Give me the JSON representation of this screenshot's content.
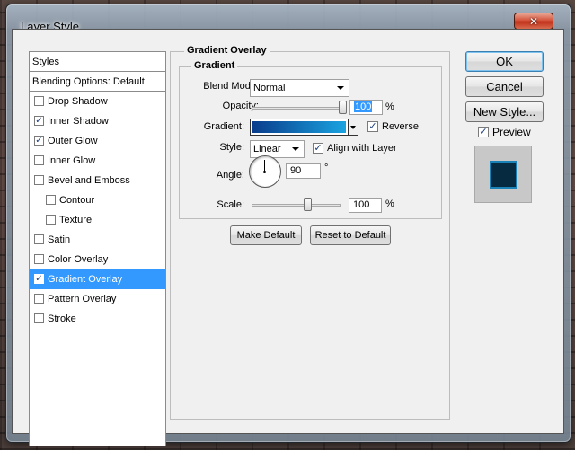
{
  "window": {
    "title": "Layer Style",
    "close_glyph": "✕"
  },
  "styles_list": {
    "header": "Styles",
    "blending": "Blending Options: Default",
    "items": [
      {
        "label": "Drop Shadow",
        "checked": false,
        "indent": false,
        "selected": false
      },
      {
        "label": "Inner Shadow",
        "checked": true,
        "indent": false,
        "selected": false
      },
      {
        "label": "Outer Glow",
        "checked": true,
        "indent": false,
        "selected": false
      },
      {
        "label": "Inner Glow",
        "checked": false,
        "indent": false,
        "selected": false
      },
      {
        "label": "Bevel and Emboss",
        "checked": false,
        "indent": false,
        "selected": false
      },
      {
        "label": "Contour",
        "checked": false,
        "indent": true,
        "selected": false
      },
      {
        "label": "Texture",
        "checked": false,
        "indent": true,
        "selected": false
      },
      {
        "label": "Satin",
        "checked": false,
        "indent": false,
        "selected": false
      },
      {
        "label": "Color Overlay",
        "checked": false,
        "indent": false,
        "selected": false
      },
      {
        "label": "Gradient Overlay",
        "checked": true,
        "indent": false,
        "selected": true
      },
      {
        "label": "Pattern Overlay",
        "checked": false,
        "indent": false,
        "selected": false
      },
      {
        "label": "Stroke",
        "checked": false,
        "indent": false,
        "selected": false
      }
    ]
  },
  "gradient_overlay": {
    "section_title": "Gradient Overlay",
    "group_title": "Gradient",
    "blend_mode_label": "Blend Mode:",
    "blend_mode_value": "Normal",
    "opacity_label": "Opacity:",
    "opacity_value": "100",
    "opacity_unit": "%",
    "opacity_level": 1.0,
    "gradient_label": "Gradient:",
    "gradient_colors": [
      "#0a3d8c",
      "#1aa3e0"
    ],
    "reverse_label": "Reverse",
    "reverse_checked": true,
    "style_label": "Style:",
    "style_value": "Linear",
    "align_label": "Align with Layer",
    "align_checked": true,
    "angle_label": "Angle:",
    "angle_value": "90",
    "angle_unit": "°",
    "scale_label": "Scale:",
    "scale_value": "100",
    "scale_unit": "%",
    "scale_level": 0.5,
    "make_default": "Make Default",
    "reset_default": "Reset to Default"
  },
  "buttons": {
    "ok": "OK",
    "cancel": "Cancel",
    "new_style": "New Style...",
    "preview_label": "Preview",
    "preview_checked": true
  },
  "check_glyph": "✓"
}
